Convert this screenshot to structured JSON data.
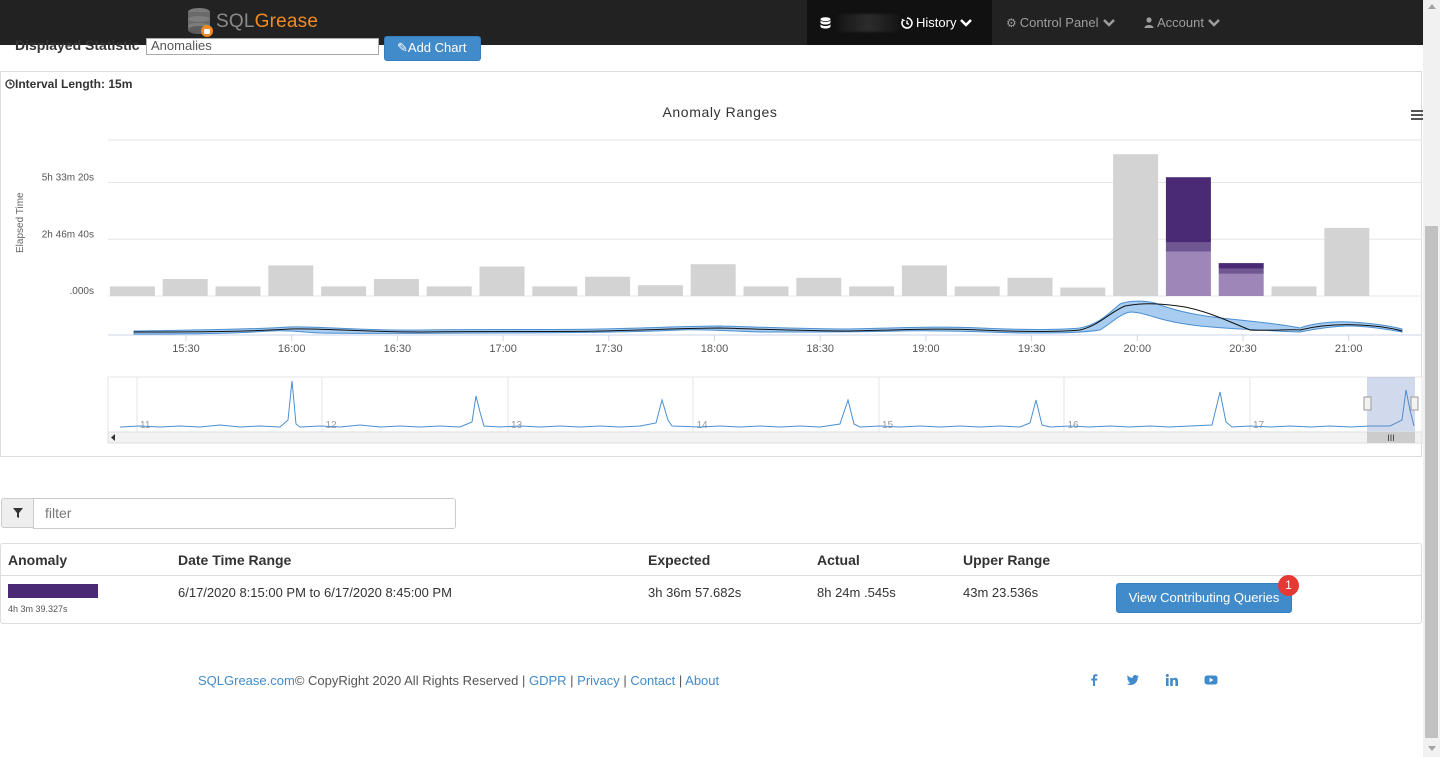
{
  "nav": {
    "brand_sql": "SQL",
    "brand_grease": "Grease",
    "history": "History",
    "control_panel": "Control Panel",
    "account": "Account"
  },
  "controls": {
    "displayed_statistic_label": "Displayed Statistic",
    "displayed_statistic_value": "Anomalies",
    "add_chart": "Add Chart"
  },
  "interval": {
    "label": "Interval Length:",
    "value": "15m"
  },
  "chart_data": {
    "type": "bar",
    "title": "Anomaly Ranges",
    "ylabel": "Elapsed Time",
    "y_ticks": [
      ".000s",
      "2h 46m 40s",
      "5h 33m 20s"
    ],
    "x_ticks": [
      "15:30",
      "16:00",
      "16:30",
      "17:00",
      "17:30",
      "18:00",
      "18:30",
      "19:00",
      "19:30",
      "20:00",
      "20:30",
      "21:00"
    ],
    "navigator_labels": [
      "11",
      "12",
      "13",
      "14",
      "15",
      "16",
      "17"
    ],
    "units": "seconds",
    "ylim": [
      0,
      27500
    ],
    "categories": [
      "15:15",
      "15:30",
      "15:45",
      "16:00",
      "16:15",
      "16:30",
      "16:45",
      "17:00",
      "17:15",
      "17:30",
      "17:45",
      "18:00",
      "18:15",
      "18:30",
      "18:45",
      "19:00",
      "19:15",
      "19:30",
      "19:45",
      "20:00",
      "20:15",
      "20:30",
      "20:45",
      "21:00"
    ],
    "series": [
      {
        "values": [
          1700,
          3000,
          1700,
          5400,
          1700,
          3000,
          1700,
          5200,
          1700,
          3400,
          1900,
          5600,
          1700,
          3200,
          1700,
          5400,
          1700,
          3200,
          1500,
          25000,
          0,
          0,
          1700,
          12000
        ],
        "color": "#d3d3d3"
      },
      {
        "values": [
          0,
          0,
          0,
          0,
          0,
          0,
          0,
          0,
          0,
          0,
          0,
          0,
          0,
          0,
          0,
          0,
          0,
          0,
          0,
          0,
          7800,
          3900,
          0,
          0
        ],
        "color": "#9e87b8"
      },
      {
        "values": [
          0,
          0,
          0,
          0,
          0,
          0,
          0,
          0,
          0,
          0,
          0,
          0,
          0,
          0,
          0,
          0,
          0,
          0,
          0,
          0,
          1650,
          900,
          0,
          0
        ],
        "color": "#6f5892"
      },
      {
        "values": [
          0,
          0,
          0,
          0,
          0,
          0,
          0,
          0,
          0,
          0,
          0,
          0,
          0,
          0,
          0,
          0,
          0,
          0,
          0,
          0,
          11500,
          1000,
          0,
          0
        ],
        "color": "#4a2a74"
      }
    ]
  },
  "filter": {
    "placeholder": "filter"
  },
  "table": {
    "headers": [
      "Anomaly",
      "Date Time Range",
      "Expected",
      "Actual",
      "Upper Range"
    ],
    "rows": [
      {
        "anomaly_value": "4h 3m 39.327s",
        "date_range": "6/17/2020 8:15:00 PM to 6/17/2020 8:45:00 PM",
        "expected": "3h 36m 57.682s",
        "actual": "8h 24m .545s",
        "upper_range": "43m 23.536s",
        "action": "View Contributing Queries",
        "badge": "1"
      }
    ]
  },
  "footer": {
    "site": "SQLGrease.com",
    "copyright": "© CopyRight 2020 All Rights Reserved",
    "sep": "|",
    "links": [
      "GDPR",
      "Privacy",
      "Contact",
      "About"
    ]
  },
  "social": [
    "facebook-icon",
    "twitter-icon",
    "linkedin-icon",
    "youtube-icon"
  ],
  "colors": {
    "brand_orange": "#f08a24",
    "primary_blue": "#428bca",
    "anomaly_purple": "#4a2a74",
    "bar_gray": "#d3d3d3",
    "line_blue": "#4a8fd1",
    "badge_red": "#e53935"
  }
}
